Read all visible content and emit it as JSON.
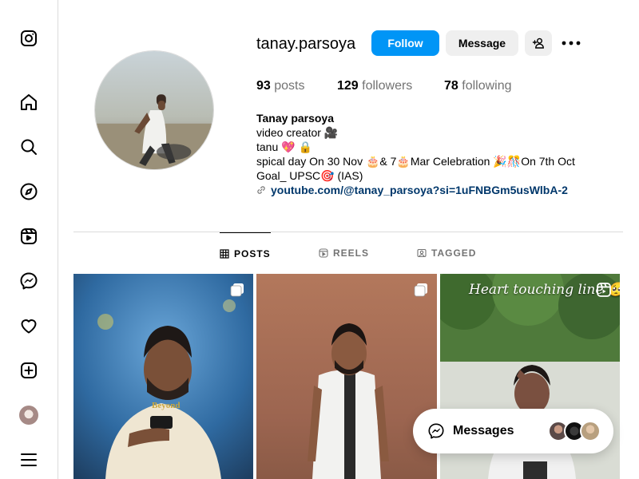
{
  "sidebar": {
    "items": [
      {
        "icon": "instagram-logo-icon"
      },
      {
        "icon": "home-icon"
      },
      {
        "icon": "search-icon"
      },
      {
        "icon": "explore-icon"
      },
      {
        "icon": "reels-icon"
      },
      {
        "icon": "messenger-icon"
      },
      {
        "icon": "heart-icon"
      },
      {
        "icon": "create-icon"
      },
      {
        "icon": "profile-avatar"
      },
      {
        "icon": "menu-icon"
      }
    ]
  },
  "profile": {
    "username": "tanay.parsoya",
    "follow_label": "Follow",
    "message_label": "Message",
    "stats": {
      "posts_count": "93",
      "posts_label": "posts",
      "followers_count": "129",
      "followers_label": "followers",
      "following_count": "78",
      "following_label": "following"
    },
    "bio": {
      "name": "Tanay parsoya",
      "lines": [
        "video creator 🎥",
        "tanu 💖 🔒",
        "spical day On 30 Nov 🎂& 7🎂Mar Celebration 🎉🎊On 7th Oct",
        "Goal_ UPSC🎯 (IAS)"
      ],
      "link": "youtube.com/@tanay_parsoya?si=1uFNBGm5usWlbA-2"
    }
  },
  "tabs": [
    {
      "label": "POSTS",
      "active": true
    },
    {
      "label": "REELS",
      "active": false
    },
    {
      "label": "TAGGED",
      "active": false
    }
  ],
  "posts": [
    {
      "type": "carousel",
      "badge": "carousel-icon"
    },
    {
      "type": "carousel",
      "badge": "carousel-icon"
    },
    {
      "type": "reel",
      "badge": "reel-icon",
      "caption": "Heart touching line 🥺"
    }
  ],
  "messages_bar": {
    "label": "Messages"
  },
  "colors": {
    "follow_blue": "#0095f6",
    "link_blue": "#00376b",
    "muted": "#737373",
    "border": "#dbdbdb"
  }
}
